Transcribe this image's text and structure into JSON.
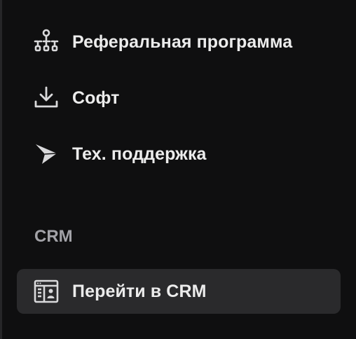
{
  "sidebar": {
    "items": [
      {
        "label": "Реферальная программа",
        "icon": "network-hierarchy-icon"
      },
      {
        "label": "Софт",
        "icon": "download-tray-icon"
      },
      {
        "label": "Тех. поддержка",
        "icon": "send-arrow-icon"
      }
    ],
    "crm_section": {
      "title": "CRM",
      "items": [
        {
          "label": "Перейти в CRM",
          "icon": "browser-window-user-icon",
          "active": true
        }
      ]
    }
  },
  "colors": {
    "background": "#0f0f10",
    "active_background": "#2a2a2c",
    "label_text": "#ececec",
    "section_title_text": "#a2a2a7",
    "icon_stroke": "#d9d9db"
  }
}
